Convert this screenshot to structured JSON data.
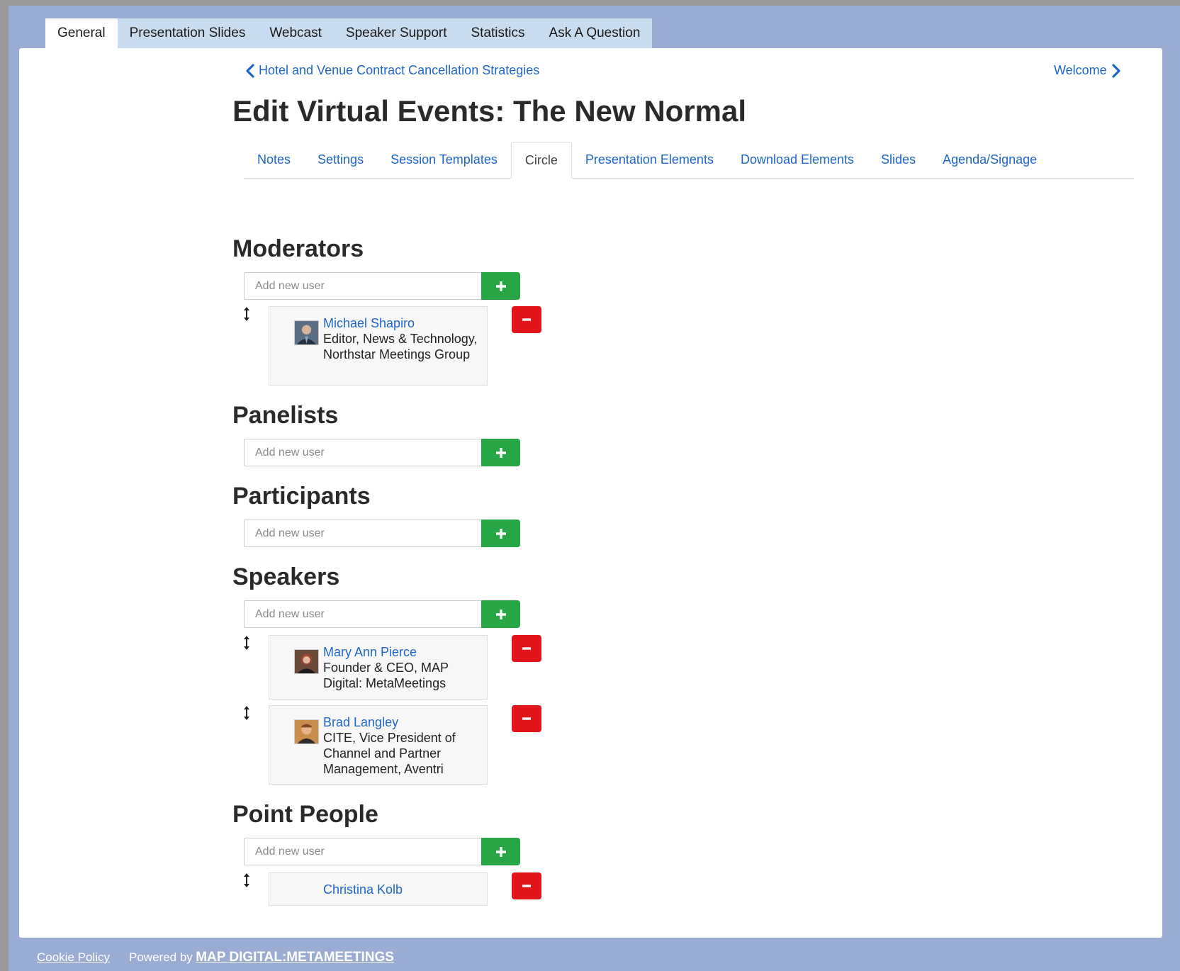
{
  "top_tabs": [
    {
      "label": "General",
      "active": true
    },
    {
      "label": "Presentation Slides"
    },
    {
      "label": "Webcast"
    },
    {
      "label": "Speaker Support"
    },
    {
      "label": "Statistics"
    },
    {
      "label": "Ask A Question"
    }
  ],
  "nav": {
    "prev_label": "Hotel and Venue Contract Cancellation Strategies",
    "next_label": "Welcome"
  },
  "page_title": "Edit Virtual Events: The New Normal",
  "sub_tabs": [
    {
      "label": "Notes"
    },
    {
      "label": "Settings"
    },
    {
      "label": "Session Templates"
    },
    {
      "label": "Circle",
      "active": true
    },
    {
      "label": "Presentation Elements"
    },
    {
      "label": "Download Elements"
    },
    {
      "label": "Slides"
    },
    {
      "label": "Agenda/Signage"
    }
  ],
  "add_placeholder": "Add new user",
  "sections": {
    "moderators": {
      "title": "Moderators",
      "users": [
        {
          "name": "Michael Shapiro",
          "title": "Editor, News & Technology, Northstar Meetings Group"
        }
      ]
    },
    "panelists": {
      "title": "Panelists",
      "users": []
    },
    "participants": {
      "title": "Participants",
      "users": []
    },
    "speakers": {
      "title": "Speakers",
      "users": [
        {
          "name": "Mary Ann Pierce",
          "title": "Founder & CEO, MAP Digital: MetaMeetings"
        },
        {
          "name": "Brad Langley",
          "title": "CITE, Vice President of Channel and Partner Management, Aventri"
        }
      ]
    },
    "point_people": {
      "title": "Point People",
      "users": [
        {
          "name": "Christina Kolb",
          "title": ""
        }
      ]
    }
  },
  "footer": {
    "cookie_label": "Cookie Policy",
    "powered_by": "Powered by",
    "brand": "MAP DIGITAL:METAMEETINGS"
  },
  "colors": {
    "frame_bg": "#9aacd4",
    "tab_strip_bg": "#c9dcef",
    "link": "#1f66c8",
    "add_button": "#26a644",
    "remove_button": "#e3151b"
  },
  "icons": {
    "prev": "chevron-left-icon",
    "next": "chevron-right-icon",
    "add": "plus-icon",
    "remove": "minus-icon",
    "drag": "drag-handle-icon"
  }
}
